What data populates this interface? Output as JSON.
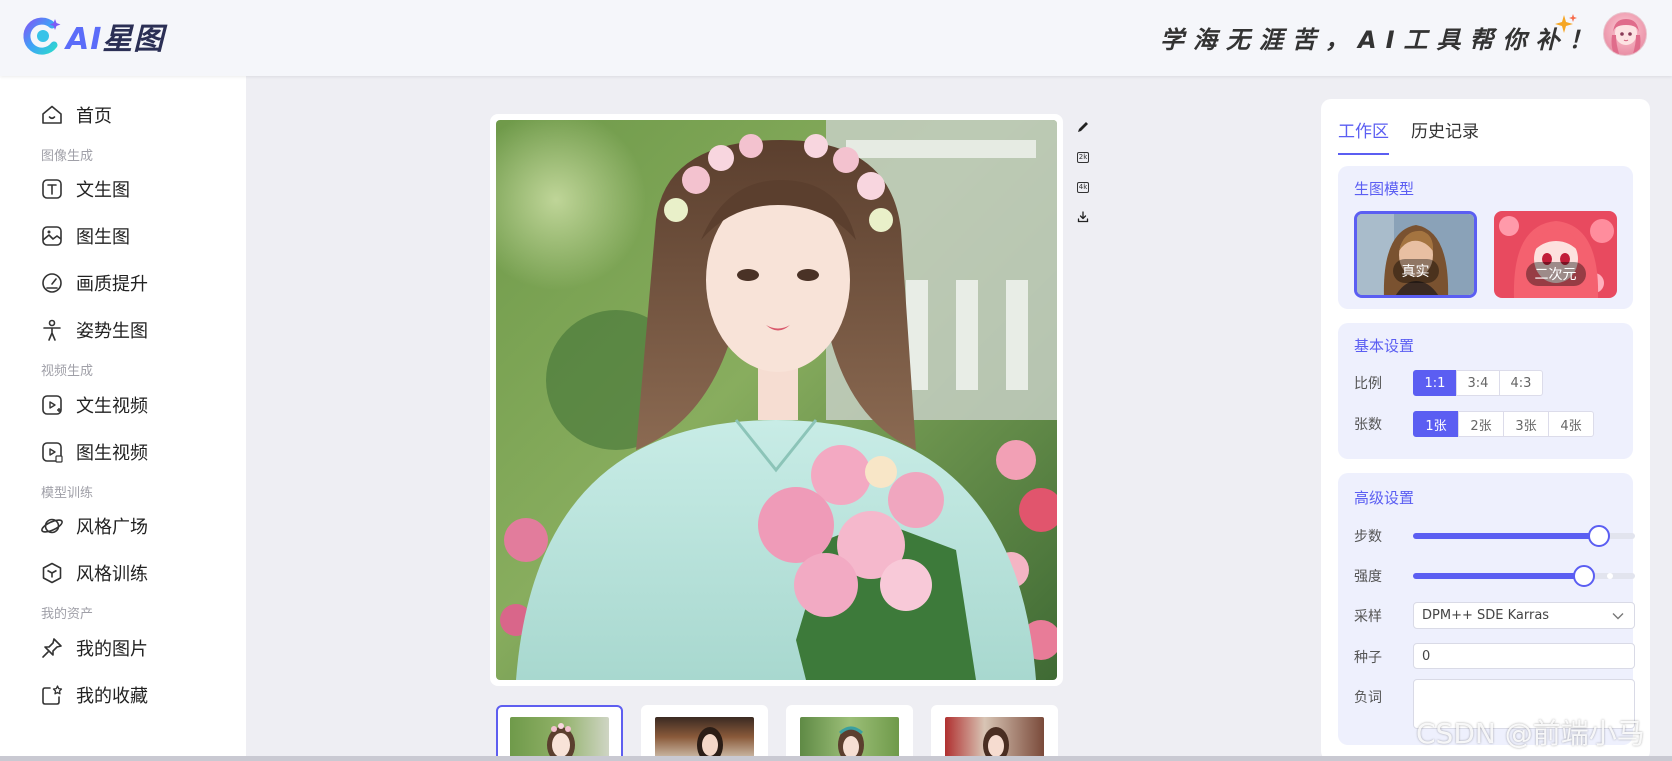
{
  "header": {
    "logo_ai": "AI",
    "logo_name": "星图",
    "slogan": "学海无涯苦，AI工具帮你补！"
  },
  "sidebar": {
    "items": [
      {
        "label": "首页",
        "icon": "home-icon"
      },
      {
        "label": "文生图",
        "icon": "text-image-icon"
      },
      {
        "label": "图生图",
        "icon": "image-image-icon"
      },
      {
        "label": "画质提升",
        "icon": "quality-gauge-icon"
      },
      {
        "label": "姿势生图",
        "icon": "pose-icon"
      },
      {
        "label": "文生视频",
        "icon": "text-video-icon"
      },
      {
        "label": "图生视频",
        "icon": "image-video-icon"
      },
      {
        "label": "风格广场",
        "icon": "planet-icon"
      },
      {
        "label": "风格训练",
        "icon": "cube-icon"
      },
      {
        "label": "我的图片",
        "icon": "pin-icon"
      },
      {
        "label": "我的收藏",
        "icon": "favorite-icon"
      }
    ],
    "sections": [
      "图像生成",
      "视频生成",
      "模型训练",
      "我的资产"
    ]
  },
  "tools": {
    "edit_icon": "pencil-icon",
    "upscale_2k": "2k",
    "upscale_4k": "4k",
    "download_icon": "download-icon"
  },
  "panel": {
    "tabs": [
      "工作区",
      "历史记录"
    ],
    "model_title": "生图模型",
    "models": [
      "真实",
      "二次元"
    ],
    "basic_title": "基本设置",
    "ratio_label": "比例",
    "ratio_options": [
      "1:1",
      "3:4",
      "4:3"
    ],
    "count_label": "张数",
    "count_options": [
      "1张",
      "2张",
      "3张",
      "4张"
    ],
    "advanced_title": "高级设置",
    "steps_label": "步数",
    "steps_value": 0.84,
    "strength_label": "强度",
    "strength_value": 0.77,
    "sampler_label": "采样",
    "sampler_value": "DPM++ SDE Karras",
    "seed_label": "种子",
    "seed_value": "0",
    "negative_label": "负词"
  },
  "watermark": "CSDN @前端小马"
}
